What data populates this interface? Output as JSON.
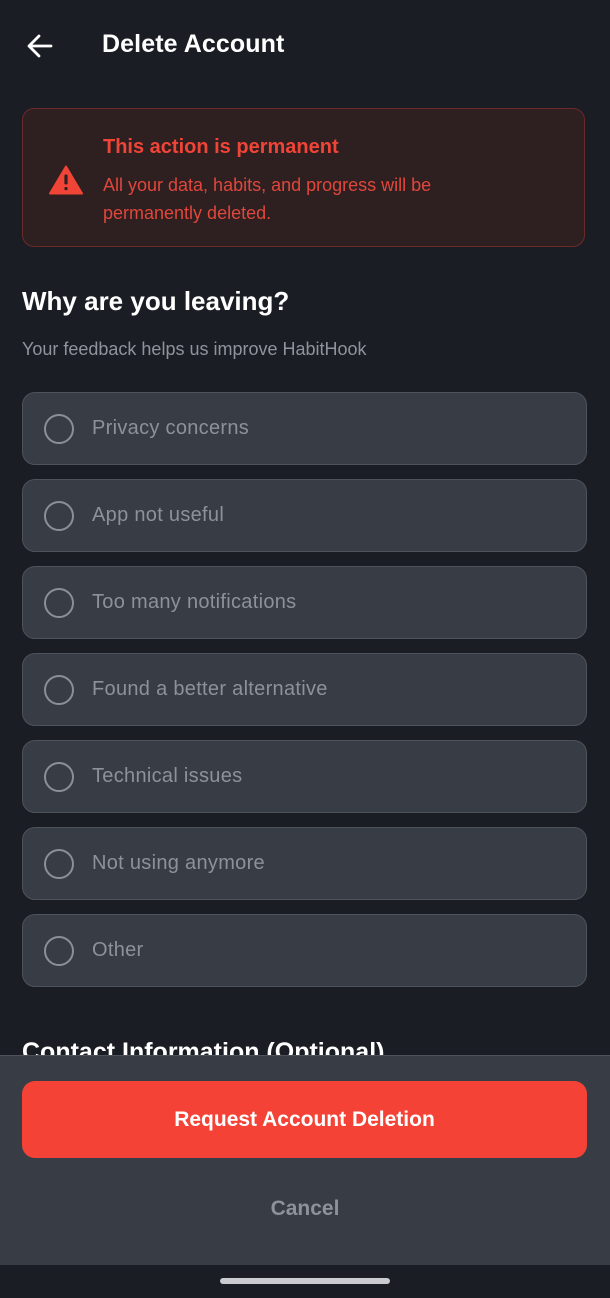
{
  "header": {
    "title": "Delete Account"
  },
  "warning": {
    "title": "This action is permanent",
    "message": "All your data, habits, and progress will be permanently deleted."
  },
  "reasons": {
    "title": "Why are you leaving?",
    "subtitle": "Your feedback helps us improve HabitHook",
    "options": [
      {
        "label": "Privacy concerns",
        "selected": false
      },
      {
        "label": "App not useful",
        "selected": false
      },
      {
        "label": "Too many notifications",
        "selected": false
      },
      {
        "label": "Found a better alternative",
        "selected": false
      },
      {
        "label": "Technical issues",
        "selected": false
      },
      {
        "label": "Not using anymore",
        "selected": false
      },
      {
        "label": "Other",
        "selected": false
      }
    ]
  },
  "contact": {
    "title": "Contact Information (Optional)"
  },
  "actions": {
    "delete_label": "Request Account Deletion",
    "cancel_label": "Cancel"
  },
  "colors": {
    "background": "#1a1d23",
    "accent_red": "#f44336",
    "warning_text": "#e0473b",
    "card": "#383c44"
  },
  "icons": {
    "back": "arrow-left-icon",
    "warning": "warning-triangle-icon",
    "radio": "radio-unchecked-icon"
  }
}
